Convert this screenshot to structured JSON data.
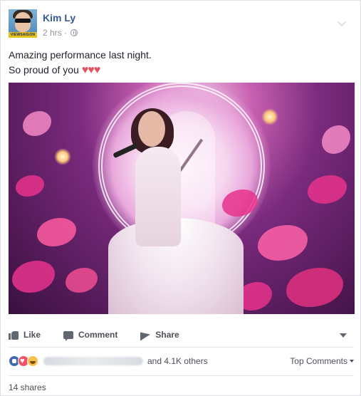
{
  "post": {
    "author": "Kim Ly",
    "time": "2 hrs",
    "time_separator": "·",
    "text_line1": "Amazing performance last night.",
    "text_line2": "So proud of you",
    "hearts": "♥♥♥",
    "avatar_badge": "VIEWSAIGON"
  },
  "actions": {
    "like": "Like",
    "comment": "Comment",
    "share": "Share"
  },
  "reactions": {
    "others_text": "and 4.1K others",
    "top_comments": "Top Comments"
  },
  "shares": "14 shares",
  "colors": {
    "author_link": "#365899",
    "meta_gray": "#90949c",
    "action_gray": "#4b4f56",
    "like_blue": "#4267b2",
    "love_red": "#f25268",
    "haha_yellow": "#f7c14c",
    "heart_red": "#e05562"
  },
  "icons": [
    "globe-icon",
    "chevron-down-icon",
    "like-icon",
    "comment-icon",
    "share-icon",
    "like-reaction-icon",
    "love-reaction-icon",
    "haha-reaction-icon"
  ]
}
